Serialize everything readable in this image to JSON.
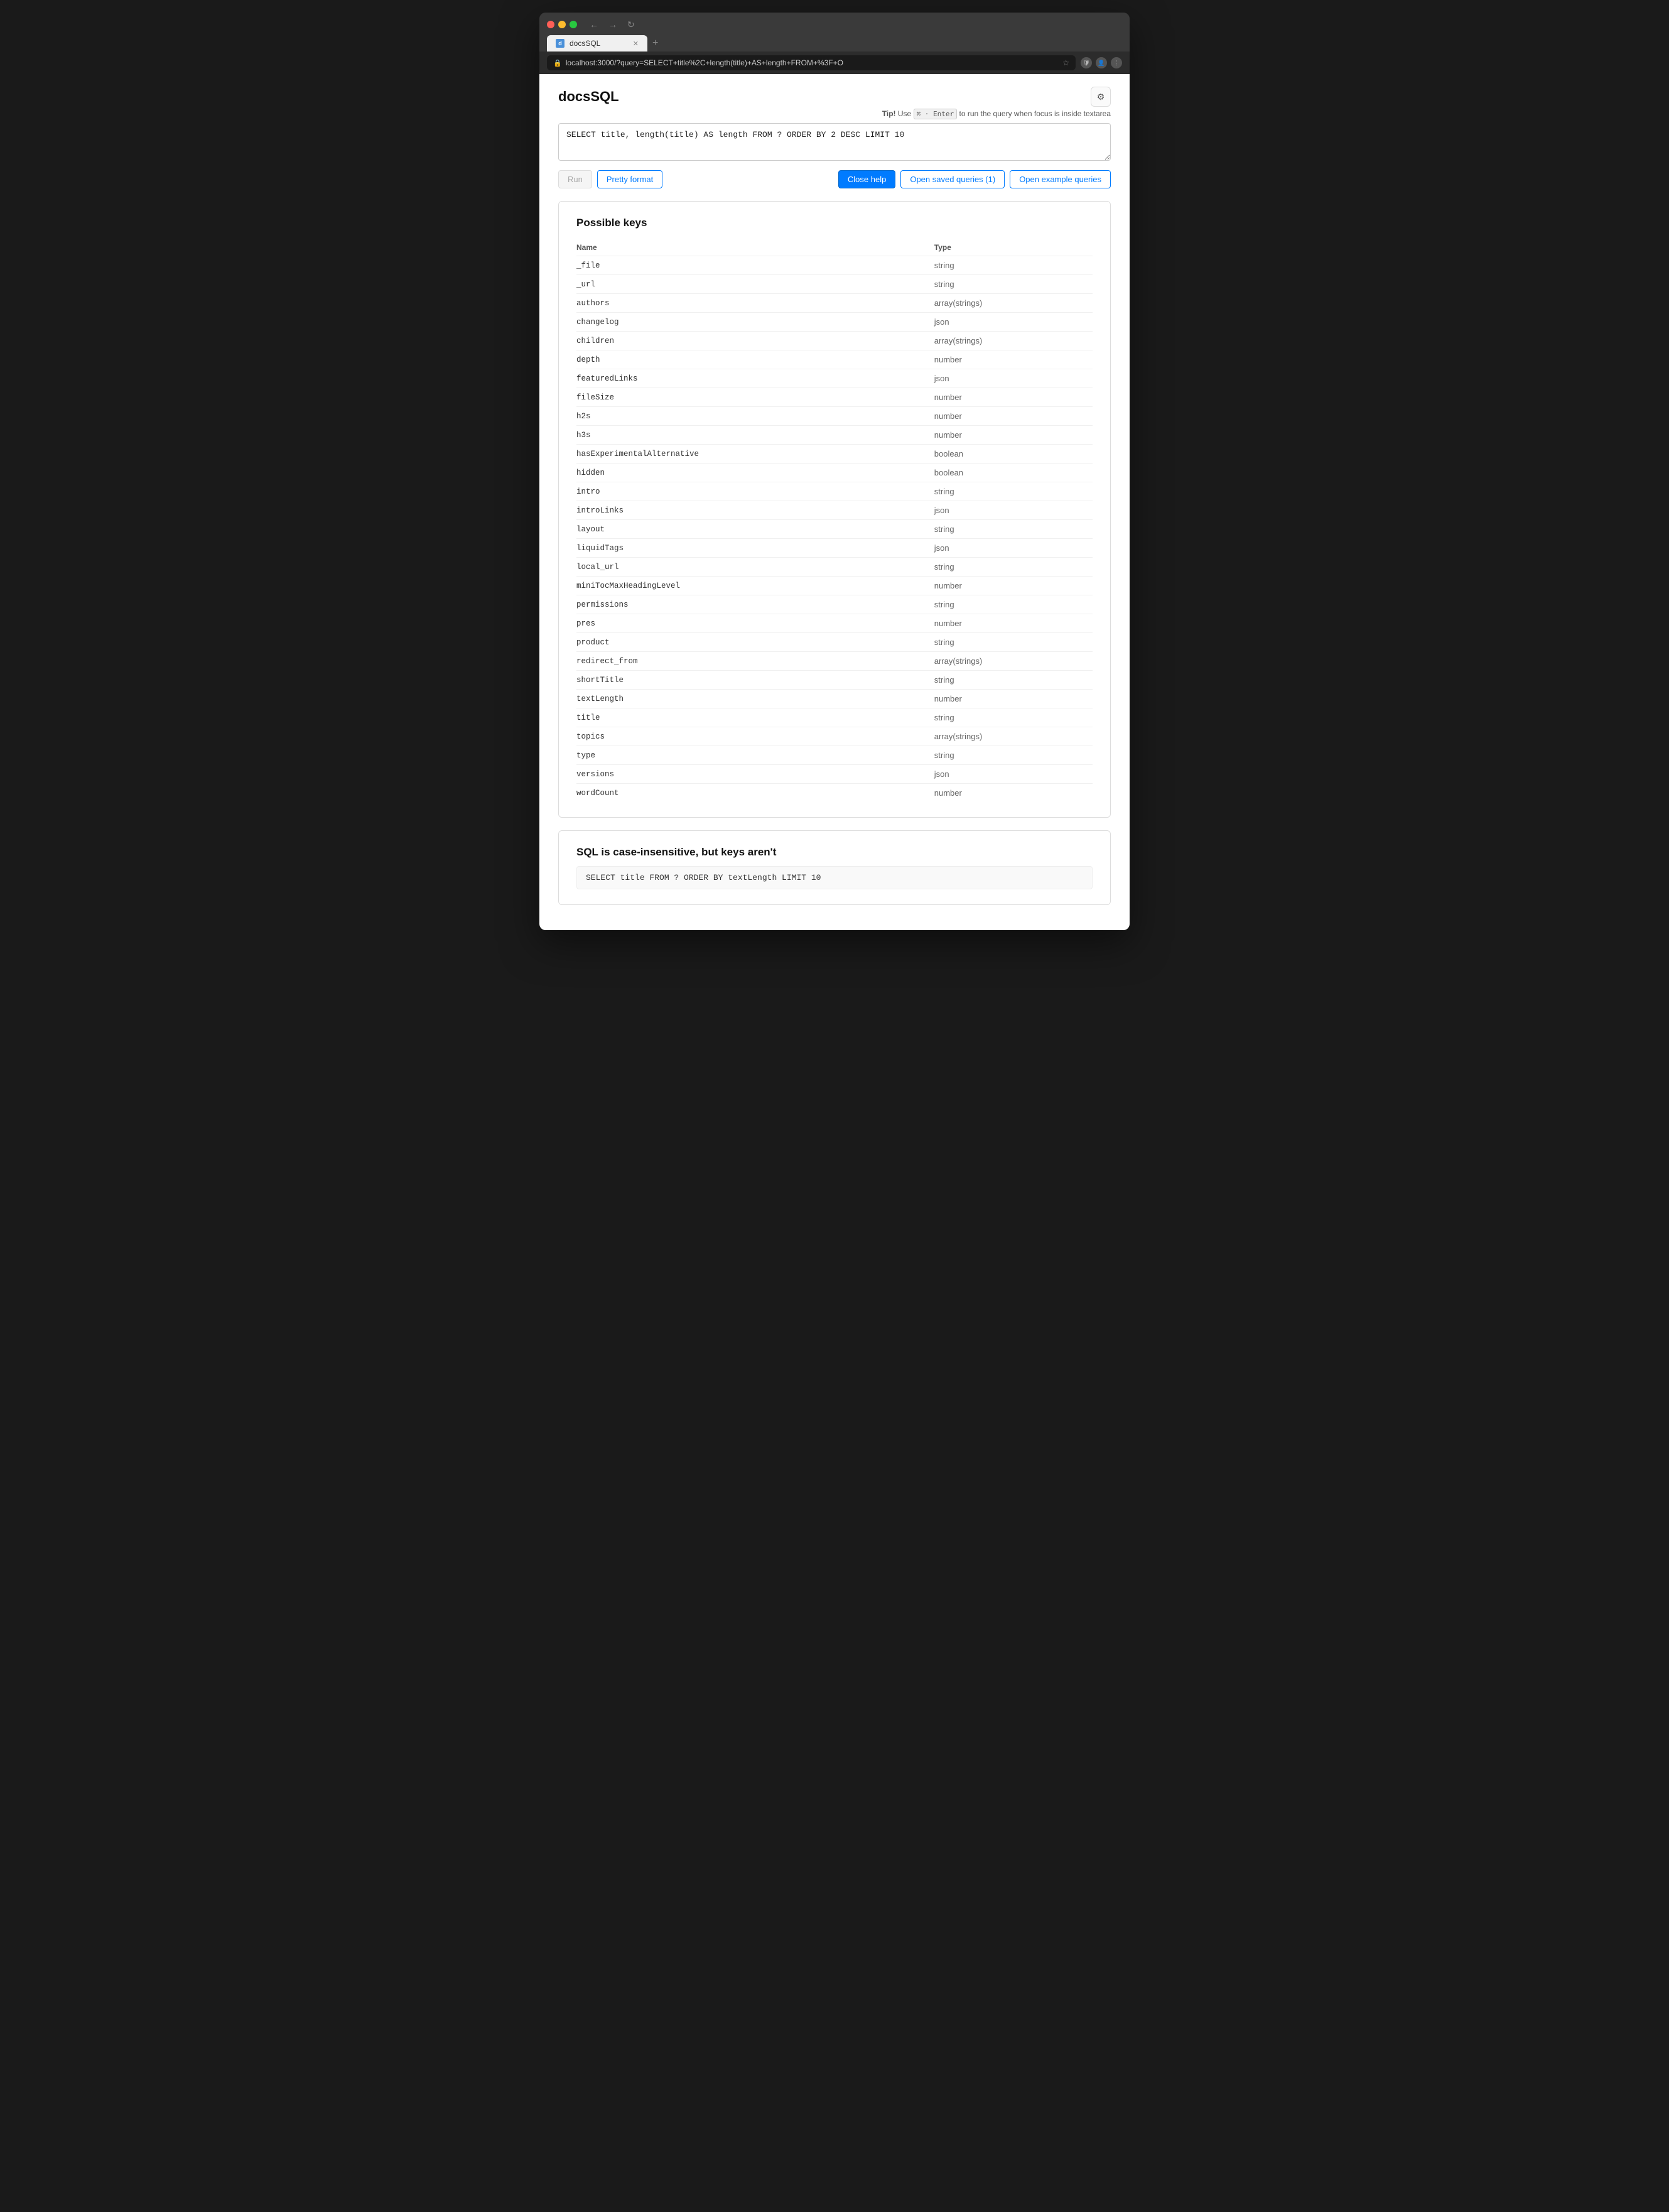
{
  "browser": {
    "tab_title": "docsSQL",
    "address": "localhost:3000/?query=SELECT+title%2C+length(title)+AS+length+FROM+%3F+O",
    "new_tab_label": "+"
  },
  "app": {
    "title": "docsSQL",
    "tip_prefix": "Tip!",
    "tip_text": " Use ",
    "tip_shortcut": "⌘ · Enter",
    "tip_suffix": " to run the query when focus is inside textarea",
    "query_value": "SELECT title, length(title) AS length FROM ? ORDER BY 2 DESC LIMIT 10"
  },
  "toolbar": {
    "run_label": "Run",
    "pretty_format_label": "Pretty format",
    "close_help_label": "Close help",
    "saved_queries_label": "Open saved queries (1)",
    "example_queries_label": "Open example queries"
  },
  "possible_keys": {
    "heading": "Possible keys",
    "col_name": "Name",
    "col_type": "Type",
    "rows": [
      {
        "name": "_file",
        "type": "string"
      },
      {
        "name": "_url",
        "type": "string"
      },
      {
        "name": "authors",
        "type": "array(strings)"
      },
      {
        "name": "changelog",
        "type": "json"
      },
      {
        "name": "children",
        "type": "array(strings)"
      },
      {
        "name": "depth",
        "type": "number"
      },
      {
        "name": "featuredLinks",
        "type": "json"
      },
      {
        "name": "fileSize",
        "type": "number"
      },
      {
        "name": "h2s",
        "type": "number"
      },
      {
        "name": "h3s",
        "type": "number"
      },
      {
        "name": "hasExperimentalAlternative",
        "type": "boolean"
      },
      {
        "name": "hidden",
        "type": "boolean"
      },
      {
        "name": "intro",
        "type": "string"
      },
      {
        "name": "introLinks",
        "type": "json"
      },
      {
        "name": "layout",
        "type": "string"
      },
      {
        "name": "liquidTags",
        "type": "json"
      },
      {
        "name": "local_url",
        "type": "string"
      },
      {
        "name": "miniTocMaxHeadingLevel",
        "type": "number"
      },
      {
        "name": "permissions",
        "type": "string"
      },
      {
        "name": "pres",
        "type": "number"
      },
      {
        "name": "product",
        "type": "string"
      },
      {
        "name": "redirect_from",
        "type": "array(strings)"
      },
      {
        "name": "shortTitle",
        "type": "string"
      },
      {
        "name": "textLength",
        "type": "number"
      },
      {
        "name": "title",
        "type": "string"
      },
      {
        "name": "topics",
        "type": "array(strings)"
      },
      {
        "name": "type",
        "type": "string"
      },
      {
        "name": "versions",
        "type": "json"
      },
      {
        "name": "wordCount",
        "type": "number"
      }
    ]
  },
  "example_section": {
    "heading": "SQL is case-insensitive, but keys aren't",
    "code": "SELECT title FROM ? ORDER BY textLength LIMIT 10"
  }
}
